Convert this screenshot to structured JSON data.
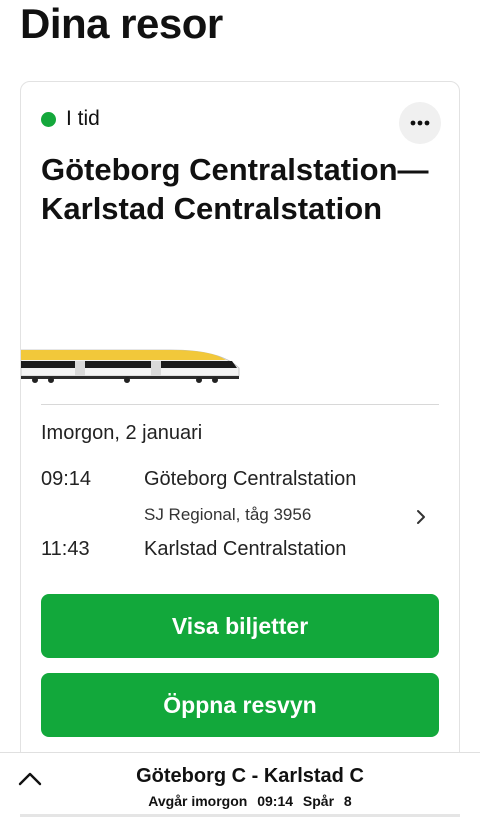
{
  "header": {
    "title": "Dina resor"
  },
  "trip_card": {
    "status": {
      "label": "I tid",
      "color": "#14a83b"
    },
    "more_icon": "more-horizontal-icon",
    "route_title": "Göteborg Centralstation—Karlstad Centralstation",
    "date": "Imorgon, 2 januari",
    "departure": {
      "time": "09:14",
      "station": "Göteborg Centralstation"
    },
    "train_info": "SJ Regional, tåg 3956",
    "arrival": {
      "time": "11:43",
      "station": "Karlstad Centralstation"
    },
    "buttons": {
      "show_tickets": "Visa biljetter",
      "open_trip_view": "Öppna resvyn"
    },
    "accent_color": "#12a83b"
  },
  "bottom_bar": {
    "route": "Göteborg C - Karlstad C",
    "departure_label": "Avgår imorgon",
    "departure_time": "09:14",
    "platform_label": "Spår",
    "platform": "8"
  }
}
